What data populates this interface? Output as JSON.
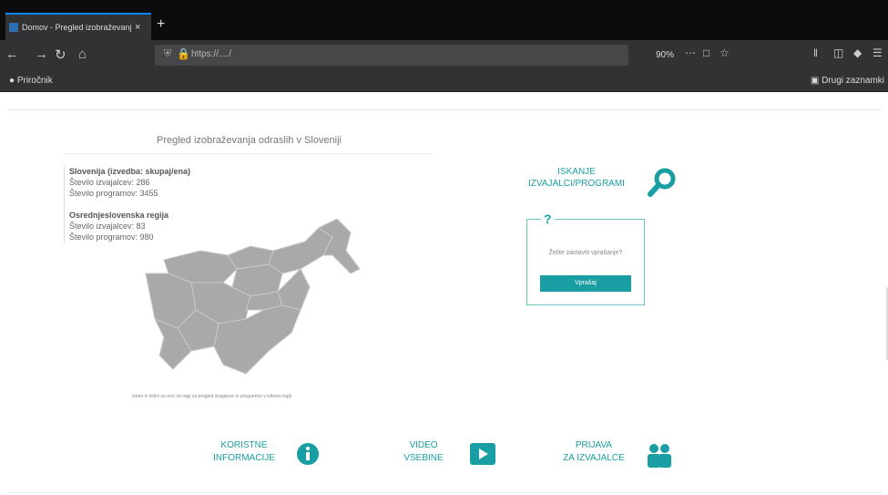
{
  "browser": {
    "tab_title": "Domov - Pregled izobraževanj",
    "tab_close": "×",
    "new_tab": "+",
    "url": "https://..../",
    "zoom": "90%",
    "nav_icons": [
      "back-icon",
      "forward-icon",
      "reload-icon",
      "home-icon"
    ],
    "bookmark_left": "Priročnik",
    "bookmark_right": "Drugi zaznamki"
  },
  "map_section": {
    "title": "Pregled izobraževanja odraslih v Sloveniji",
    "slovenia_label": "Slovenija (izvedba: skupaj/ena)",
    "slovenia_providers": "Število izvajalcev: 286",
    "slovenia_programs": "Število programov: 3455",
    "region_label": "Osrednjeslovenska regija",
    "region_providers": "Število izvajalcev: 83",
    "region_programs": "Število programov: 980",
    "caption": "Izberi in klikni na eno od regij za pregled izvajalcev in programov v izbrani regiji"
  },
  "search": {
    "line1": "ISKANJE",
    "line2": "IZVAJALCI/PROGRAMI",
    "icon": "search-icon"
  },
  "help_box": {
    "mark": "?",
    "text": "Želite zastaviti vprašanje?",
    "button": "Vprašaj"
  },
  "footer": {
    "items": [
      {
        "line1": "KORISTNE",
        "line2": "INFORMACIJE",
        "icon": "info-icon"
      },
      {
        "line1": "VIDEO",
        "line2": "VSEBINE",
        "icon": "video-play-icon"
      },
      {
        "line1": "PRIJAVA",
        "line2": "ZA IZVAJALCE",
        "icon": "users-icon"
      }
    ]
  },
  "colors": {
    "accent": "#199fa3",
    "map": "#a9a9a9"
  }
}
